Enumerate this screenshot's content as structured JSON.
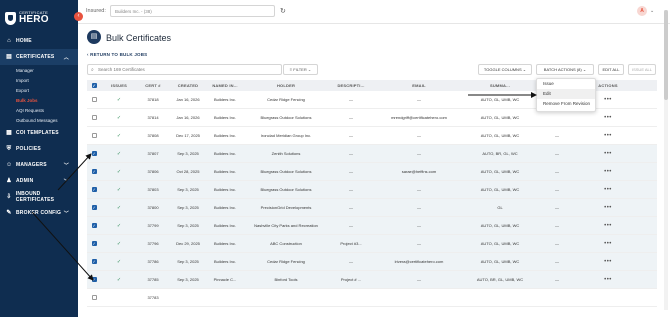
{
  "sidebar": {
    "logo_small": "CERTIFICATE",
    "logo_big": "HERO",
    "items": [
      {
        "label": "HOME",
        "icon": "home-icon",
        "glyph": "⌂"
      },
      {
        "label": "CERTIFICATES",
        "icon": "certificate-icon",
        "glyph": "▤",
        "expanded": true
      },
      {
        "label": "COI TEMPLATES",
        "icon": "template-icon",
        "glyph": "▦"
      },
      {
        "label": "POLICIES",
        "icon": "shield-icon",
        "glyph": "⛨"
      },
      {
        "label": "MANAGERS",
        "icon": "users-icon",
        "glyph": "☺"
      },
      {
        "label": "ADMIN",
        "icon": "admin-icon",
        "glyph": "♟"
      },
      {
        "label": "INBOUND CERTIFICATES",
        "icon": "inbound-icon",
        "glyph": "⇩"
      },
      {
        "label": "BROKER CONFIG",
        "icon": "wrench-icon",
        "glyph": "✎"
      }
    ],
    "subitems": [
      "Manager",
      "Import",
      "Export",
      "Bulk Jobs",
      "AQI Requests",
      "Outbound Messages"
    ],
    "active_sub": 3
  },
  "topbar": {
    "insured_label": "Insured:",
    "insured_value": "Builders Inc. - (38)",
    "avatar": "A"
  },
  "page": {
    "title": "Bulk Certificates",
    "back_link": "RETURN TO BULK JOBS",
    "search_placeholder": "Search 169 Certificates",
    "filter": "FILTER",
    "toggle_columns": "TOGGLE COLUMNS",
    "batch_actions": "BATCH ACTIONS (8)",
    "edit_all": "EDIT ALL",
    "issue_all": "ISSUE ALL"
  },
  "dropdown": [
    "Issue",
    "Edit",
    "Remove From Revision"
  ],
  "columns": [
    "",
    "ISSUES",
    "CERT #",
    "CREATED",
    "NAMED IN...",
    "HOLDER",
    "DESCRIPTI...",
    "EMAIL",
    "SUMMA...",
    "",
    "ACTIONS"
  ],
  "rows": [
    {
      "sel": false,
      "cert": "37818",
      "created": "Jan 16, 2026",
      "named": "Builders Inc.",
      "holder": "Cedar Ridge Fencing",
      "desc": "—",
      "email": "—",
      "summary": "AUTO, GL, UMB, WC",
      "extra": ""
    },
    {
      "sel": false,
      "cert": "37814",
      "created": "Jan 16, 2026",
      "named": "Builders Inc.",
      "holder": "Bluegrass Outdoor Solutions",
      "desc": "—",
      "email": "mrendgriff@certificatehero.com",
      "summary": "AUTO, GL, UMB, WC",
      "extra": ""
    },
    {
      "sel": false,
      "cert": "37808",
      "created": "Dec 17, 2025",
      "named": "Builders Inc.",
      "holder": "Ironclad Meridian Group Inc.",
      "desc": "—",
      "email": "—",
      "summary": "AUTO, GL, UMB, WC",
      "extra": "—"
    },
    {
      "sel": true,
      "cert": "37807",
      "created": "Sep 3, 2025",
      "named": "Builders Inc.",
      "holder": "Zenith Solutions",
      "desc": "—",
      "email": "—",
      "summary": "AUTO, BR, GL, WC",
      "extra": "—"
    },
    {
      "sel": true,
      "cert": "37806",
      "created": "Oct 28, 2025",
      "named": "Builders Inc.",
      "holder": "Bluegrass Outdoor Solutions",
      "desc": "—",
      "email": "sarae@heffins.com",
      "summary": "AUTO, GL, UMB, WC",
      "extra": "—"
    },
    {
      "sel": true,
      "cert": "37803",
      "created": "Sep 3, 2025",
      "named": "Builders Inc.",
      "holder": "Bluegrass Outdoor Solutions",
      "desc": "—",
      "email": "—",
      "summary": "AUTO, GL, UMB, WC",
      "extra": "—"
    },
    {
      "sel": true,
      "cert": "37800",
      "created": "Sep 3, 2025",
      "named": "Builders Inc.",
      "holder": "PrecisionGrid Developments",
      "desc": "—",
      "email": "—",
      "summary": "GL",
      "extra": "—"
    },
    {
      "sel": true,
      "cert": "37799",
      "created": "Sep 3, 2025",
      "named": "Builders Inc.",
      "holder": "Nashville City Parks and Recreation",
      "desc": "—",
      "email": "—",
      "summary": "AUTO, GL, UMB, WC",
      "extra": "—"
    },
    {
      "sel": true,
      "cert": "37796",
      "created": "Dec 29, 2025",
      "named": "Builders Inc.",
      "holder": "ABC Construction",
      "desc": "Project #3...",
      "email": "—",
      "summary": "AUTO, GL, UMB, WC",
      "extra": "—"
    },
    {
      "sel": true,
      "cert": "37786",
      "created": "Sep 3, 2025",
      "named": "Builders Inc.",
      "holder": "Cedar Ridge Fencing",
      "desc": "—",
      "email": "lrivera@certificatehero.com",
      "summary": "AUTO, GL, UMB, WC",
      "extra": "—"
    },
    {
      "sel": true,
      "cert": "37785",
      "created": "Sep 3, 2025",
      "named": "Pinnacle C...",
      "holder": "Binford Tools",
      "desc": "Project # ...",
      "email": "—",
      "summary": "AUTO, BR, GL, UMB, WC",
      "extra": "—"
    },
    {
      "sel": false,
      "cert": "37783",
      "created": "",
      "named": "",
      "holder": "",
      "desc": "",
      "email": "",
      "summary": "",
      "extra": ""
    }
  ],
  "colors": {
    "sidebar": "#0f2d50",
    "accent": "#e8533f",
    "selected_row": "#eef3f6"
  }
}
